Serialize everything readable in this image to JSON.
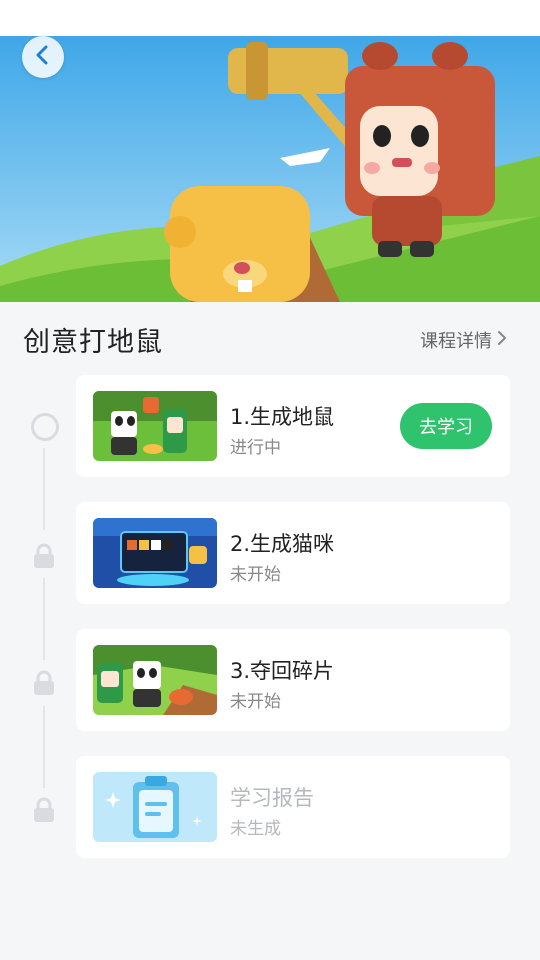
{
  "course": {
    "title": "创意打地鼠",
    "detail_link": "课程详情"
  },
  "lessons": [
    {
      "title": "1.生成地鼠",
      "status": "进行中",
      "action": "去学习",
      "locked": false
    },
    {
      "title": "2.生成猫咪",
      "status": "未开始",
      "locked": true
    },
    {
      "title": "3.夺回碎片",
      "status": "未开始",
      "locked": true
    },
    {
      "title": "学习报告",
      "status": "未生成",
      "locked": true
    }
  ],
  "colors": {
    "accent_green": "#2fc36e",
    "timeline_gray": "#d9dbe0",
    "page_bg": "#f5f6f8"
  },
  "icons": {
    "back": "chevron-left-icon",
    "detail": "chevron-right-icon",
    "lock": "lock-icon",
    "progress_node": "circle-icon"
  }
}
